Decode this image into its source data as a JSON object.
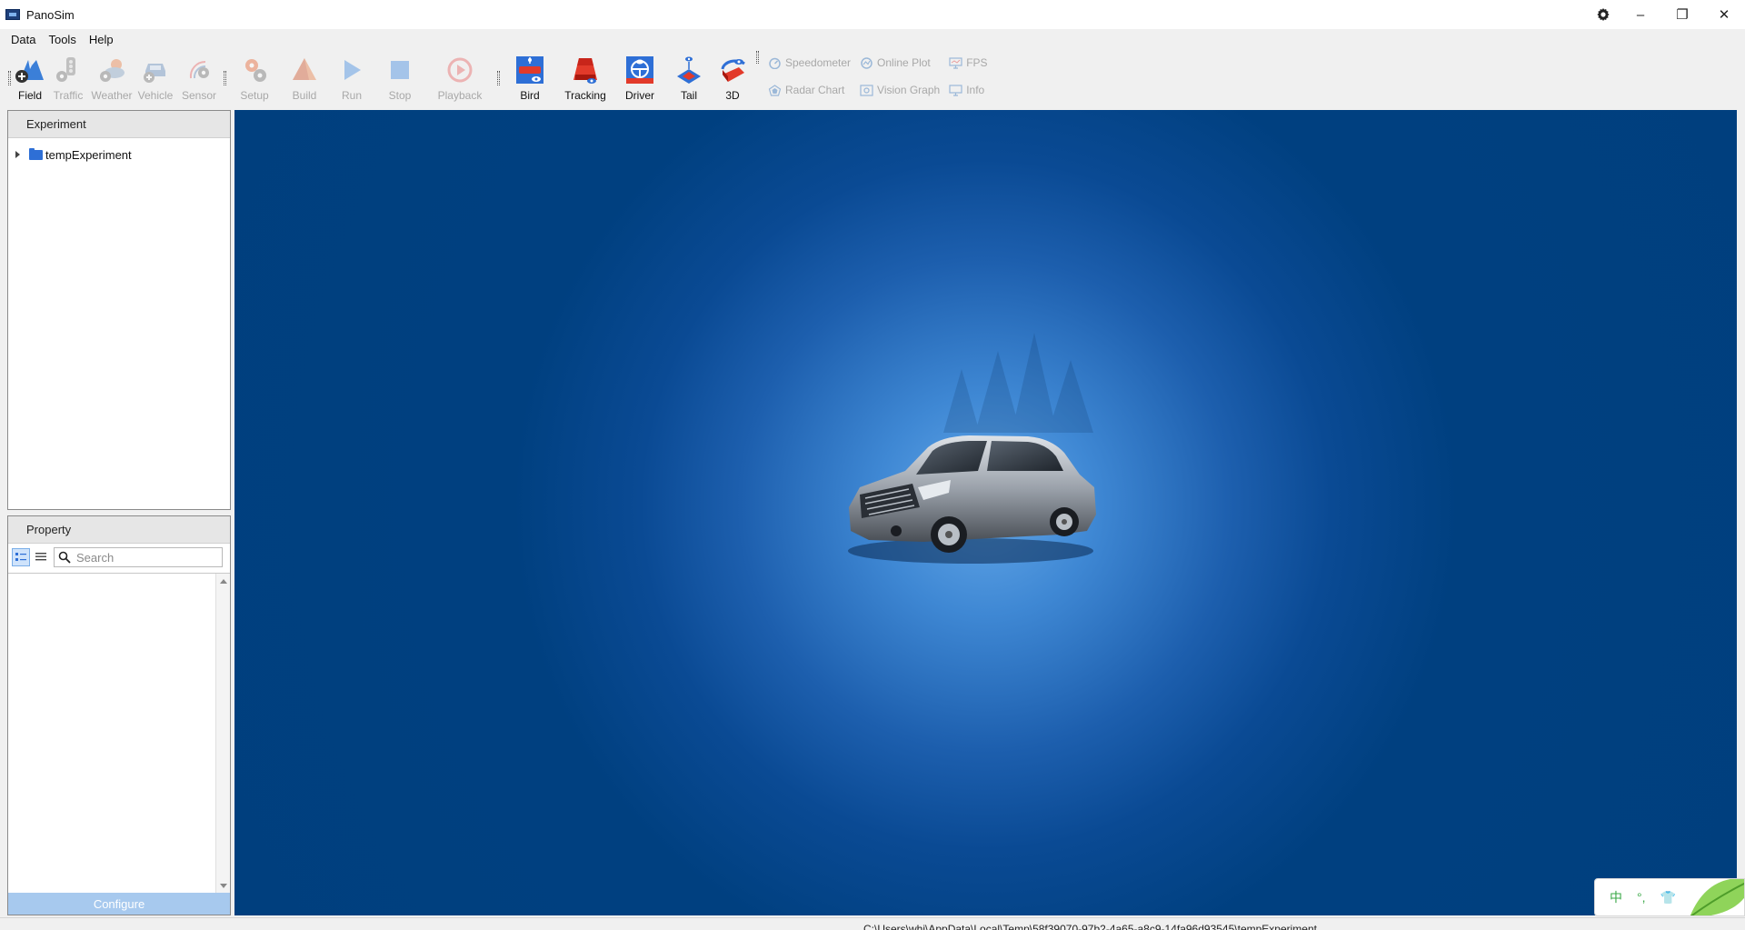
{
  "window": {
    "title": "PanoSim",
    "controls": {
      "minimize": "–",
      "restore": "❐",
      "close": "✕"
    }
  },
  "menu": [
    {
      "label": "Data"
    },
    {
      "label": "Tools"
    },
    {
      "label": "Help"
    }
  ],
  "toolbar": {
    "buttons": [
      {
        "key": "field",
        "label": "Field",
        "enabled": true
      },
      {
        "key": "traffic",
        "label": "Traffic",
        "enabled": false
      },
      {
        "key": "weather",
        "label": "Weather",
        "enabled": false
      },
      {
        "key": "vehicle",
        "label": "Vehicle",
        "enabled": false
      },
      {
        "key": "sensor",
        "label": "Sensor",
        "enabled": false
      },
      {
        "key": "setup",
        "label": "Setup",
        "enabled": false
      },
      {
        "key": "build",
        "label": "Build",
        "enabled": false
      },
      {
        "key": "run",
        "label": "Run",
        "enabled": false
      },
      {
        "key": "stop",
        "label": "Stop",
        "enabled": false
      },
      {
        "key": "playback",
        "label": "Playback",
        "enabled": false
      },
      {
        "key": "bird",
        "label": "Bird",
        "enabled": true
      },
      {
        "key": "tracking",
        "label": "Tracking",
        "enabled": true
      },
      {
        "key": "driver",
        "label": "Driver",
        "enabled": true
      },
      {
        "key": "tail",
        "label": "Tail",
        "enabled": true
      },
      {
        "key": "3d",
        "label": "3D",
        "enabled": true
      }
    ],
    "mini": [
      {
        "label": "Speedometer",
        "enabled": false
      },
      {
        "label": "Online Plot",
        "enabled": false
      },
      {
        "label": "FPS",
        "enabled": false
      },
      {
        "label": "Radar Chart",
        "enabled": false
      },
      {
        "label": "Vision Graph",
        "enabled": false
      },
      {
        "label": "Info",
        "enabled": false
      }
    ]
  },
  "experiment_panel": {
    "title": "Experiment",
    "tree": [
      {
        "label": "tempExperiment",
        "expanded": false
      }
    ]
  },
  "property_panel": {
    "title": "Property",
    "search_placeholder": "Search",
    "configure_label": "Configure"
  },
  "status": {
    "path": "C:\\Users\\whj\\AppData\\Local\\Temp\\58f39070-97b2-4a65-a8c9-14fa96d93545\\tempExperiment"
  },
  "ime": {
    "items": [
      "中",
      "°,",
      "👕"
    ]
  },
  "colors": {
    "viewport_bg": "#003f7e",
    "viewport_glow": "#63a7e8",
    "accent_blue": "#2e6fd6",
    "accent_red": "#e23a2a",
    "disabled_text": "#a8a8a8",
    "configure_bg": "#a7c9ee"
  }
}
